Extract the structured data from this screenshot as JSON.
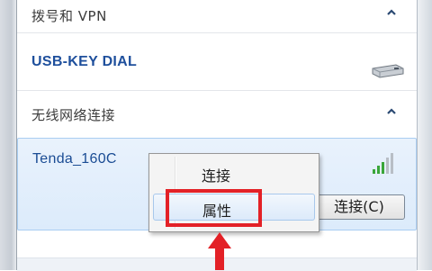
{
  "sections": {
    "dialup": {
      "title": "拨号和 VPN",
      "chevron_icon": "chevron-up-icon"
    },
    "wireless": {
      "title": "无线网络连接",
      "chevron_icon": "chevron-up-icon"
    }
  },
  "connections": {
    "usb": {
      "name": "USB-KEY DIAL",
      "icon": "usb-modem-icon"
    },
    "wifi": {
      "name": "Tenda_160C",
      "icon": "wifi-signal-icon",
      "connect_label": "连接(C)"
    }
  },
  "context_menu": {
    "items": [
      {
        "label": "连接"
      },
      {
        "label": "属性"
      }
    ]
  },
  "annotation": {
    "highlight_color": "#e32127",
    "arrow_color": "#e32127"
  },
  "colors": {
    "link_blue": "#1e4f9c",
    "selection_bg": "#dcebfb",
    "selection_border": "#a9cdf2"
  }
}
